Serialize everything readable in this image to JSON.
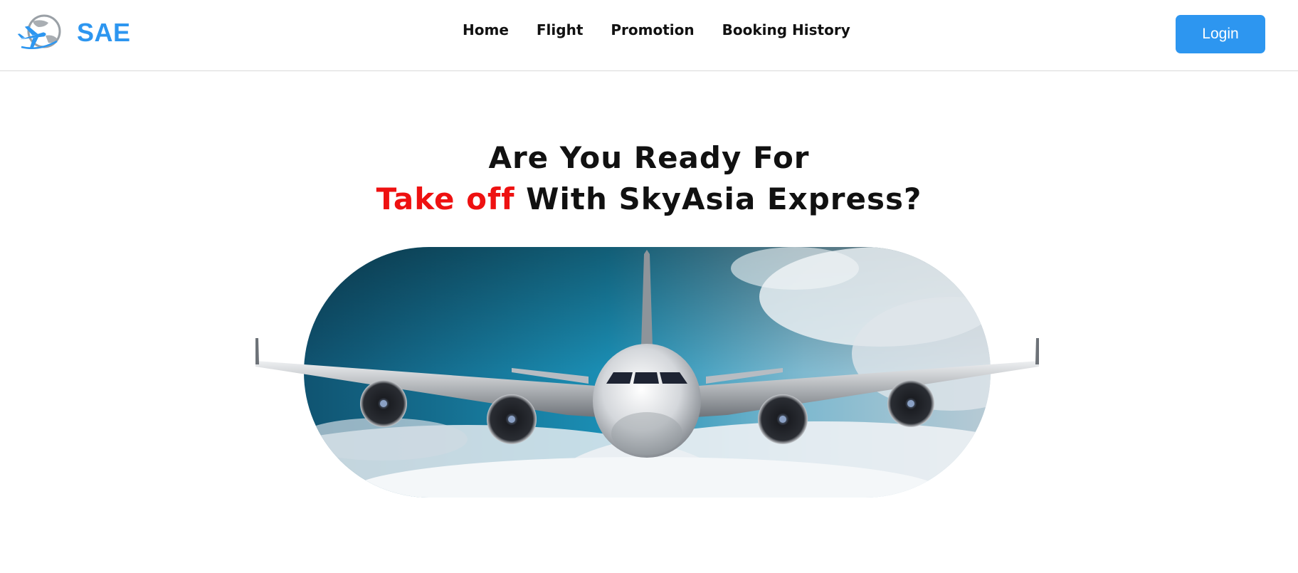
{
  "brand": {
    "name": "SAE",
    "logo_icon": "airplane-globe-icon"
  },
  "nav": {
    "items": [
      {
        "label": "Home"
      },
      {
        "label": "Flight"
      },
      {
        "label": "Promotion"
      },
      {
        "label": "Booking History"
      }
    ]
  },
  "header": {
    "login_label": "Login"
  },
  "hero": {
    "line1": "Are You Ready For",
    "line2_accent": "Take off",
    "line2_rest": " With SkyAsia Express?",
    "image": "airplane-in-clouds-image"
  },
  "colors": {
    "brand": "#2d96f0",
    "accent": "#ee1111",
    "text": "#111111"
  }
}
